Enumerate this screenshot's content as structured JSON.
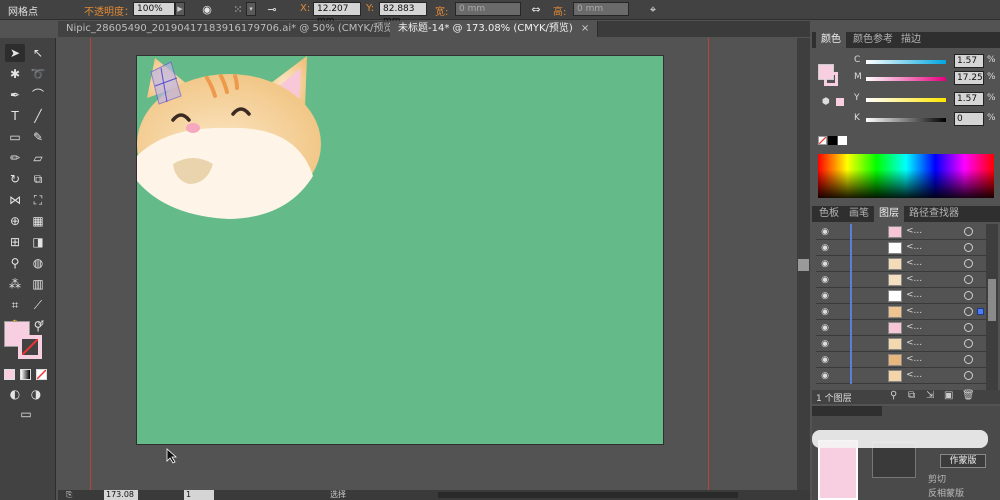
{
  "control_bar": {
    "tool_name": "网格点",
    "opacity_label": "不透明度：",
    "opacity_value": "100%",
    "x_label": "X:",
    "x_value": "12.207 mm",
    "y_label": "Y:",
    "y_value": "82.883 mm",
    "w_label": "宽:",
    "w_value": "0 mm",
    "h_label": "高:",
    "h_value": "0 mm"
  },
  "tabs": [
    {
      "label": "Nipic_28605490_20190417183916179706.ai* @ 50% (CMYK/预览)",
      "close": "×"
    },
    {
      "label": "未标题-14* @ 173.08% (CMYK/预览)",
      "close": "×"
    }
  ],
  "color_panel": {
    "tabs": [
      "颜色",
      "颜色参考",
      "描边"
    ],
    "channels": [
      {
        "letter": "C",
        "value": "1.57",
        "unit": "%",
        "gradient": "linear-gradient(to right,#ffffff,#00a6e0)"
      },
      {
        "letter": "M",
        "value": "17.25",
        "unit": "%",
        "gradient": "linear-gradient(to right,#ffffff,#e6007e)"
      },
      {
        "letter": "Y",
        "value": "1.57",
        "unit": "%",
        "gradient": "linear-gradient(to right,#ffffff,#ffe600)"
      },
      {
        "letter": "K",
        "value": "0",
        "unit": "%",
        "gradient": "linear-gradient(to right,#ffffff,#000000)"
      }
    ],
    "fill_color": "#f8cfe0"
  },
  "layers_panel": {
    "tabs": [
      "色板",
      "画笔",
      "图层",
      "路径查找器"
    ],
    "rows": [
      {
        "name": "<...",
        "thumb": "#f6c6d4"
      },
      {
        "name": "<...",
        "thumb": "#ffffff"
      },
      {
        "name": "<...",
        "thumb": "#f5dcb8"
      },
      {
        "name": "<...",
        "thumb": "#f4e0c0"
      },
      {
        "name": "<...",
        "thumb": "#ffffff"
      },
      {
        "name": "<...",
        "thumb": "#f0c48e"
      },
      {
        "name": "<...",
        "thumb": "#f6c6d4"
      },
      {
        "name": "<...",
        "thumb": "#f4d9b0"
      },
      {
        "name": "<...",
        "thumb": "#e9b77e"
      },
      {
        "name": "<...",
        "thumb": "#f4d4a8"
      }
    ],
    "count_label": "1 个图层"
  },
  "lower_panel": {
    "make_mask": "作蒙版",
    "clip": "剪切",
    "invert_mask": "反相蒙版"
  },
  "status_bar": {
    "zoom": "173.08",
    "page": "1",
    "mode": "选择"
  },
  "colors": {
    "artboard": "#64bb89",
    "guide": "#b8453a",
    "accent_orange": "#e08a36"
  }
}
